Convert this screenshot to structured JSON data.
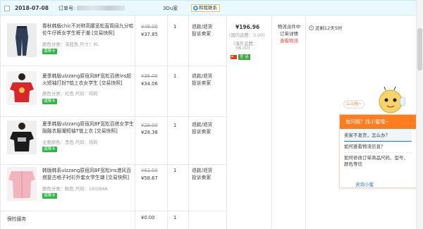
{
  "header": {
    "date": "2018-07-08",
    "order_label": "订单号:",
    "shop": "3Du家",
    "chat_label": "和我联系"
  },
  "items": [
    {
      "title": "春秋韩版chic不对称高腰宽松直筒阔九分哈伦牛仔裤女学生裤子潮 [交易快照]",
      "spec": "颜色分类：深蓝色   尺寸：XL",
      "badge": "保障卡",
      "orig_price": "¥49.00",
      "price": "¥37.85",
      "qty": "1",
      "service1": "退款/退货",
      "service2": "投诉卖家"
    },
    {
      "title": "夏季韩版ulzzang原宿风BF宽松百搭ins超火短袖打扮T恤上衣女学生 [交易快照]",
      "spec": "颜色分类：红色   尺码：均码",
      "badge": "保障卡",
      "orig_price": "¥36.00",
      "price": "¥34.06",
      "qty": "1",
      "service1": "退款/退货",
      "service2": "投诉卖家"
    },
    {
      "title": "夏季韩版ulzzang原宿风BF宽松百搭女学生融融衣服潮短袖T恤上衣 [交易快照]",
      "spec": "主要颜色：黑色   尺码：均码",
      "badge": "保障卡",
      "orig_price": "¥29.00",
      "price": "¥28.38",
      "qty": "1",
      "service1": "退款/退货",
      "service2": "投诉卖家"
    },
    {
      "title": "韩版韩系ulzzang原宿风BF宽松ins港风百搭复古格子衬衫外套女学生潮 [交易快照]",
      "spec": "颜色分类：粉色   尺码：160/84A",
      "badge": "保障卡",
      "orig_price": "¥62.00",
      "price": "¥58.67",
      "qty": "1",
      "service1": "退款/退货",
      "service2": "投诉卖家"
    }
  ],
  "summary": {
    "total": "¥196.96",
    "domestic_fee": "(国内运费：0.00)",
    "overseas_fee_1": "(海外运费：",
    "overseas_fee_2": "38.00)",
    "wechat": "官 话"
  },
  "logistics": {
    "status_1": "物流派件中",
    "status_2": "订单详情",
    "link": "查看物流",
    "remaining": "还剩12天5时"
  },
  "insurance": {
    "label": "保险服务",
    "price": "¥0.00",
    "qty": "1"
  },
  "assistant": {
    "bubble": "么么哒~",
    "header": "有问题？找小蜜哦~",
    "questions": [
      "卖家不发货，怎么办？",
      "如何查看物流信息？",
      "如何修改订单商品尺码、型号、颜色等信",
      ""
    ],
    "link": "咨询小蜜"
  }
}
